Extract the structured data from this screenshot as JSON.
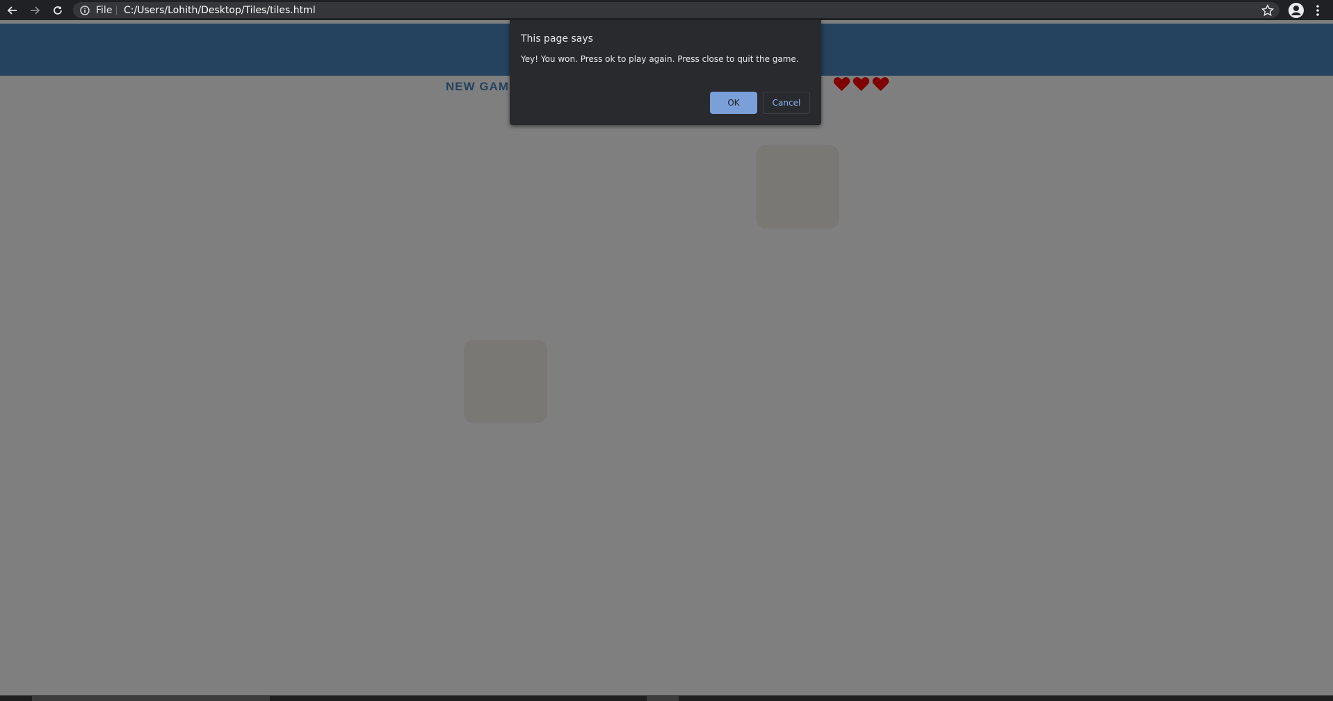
{
  "browser": {
    "scheme_label": "File",
    "url": "C:/Users/Lohith/Desktop/Tiles/tiles.html",
    "icons": {
      "back": "arrow-left-icon",
      "forward": "arrow-right-icon",
      "reload": "reload-icon",
      "info": "info-icon",
      "bookmark": "star-icon",
      "account": "account-icon",
      "menu": "kebab-menu-icon"
    }
  },
  "game": {
    "new_game_label": "NEW GAME",
    "lives": 3,
    "colors": {
      "header": "#4a86bd",
      "heart": "#ff0000",
      "tile": "#f4f0ea"
    }
  },
  "dialog": {
    "title": "This page says",
    "message": "Yey! You won. Press ok to play again. Press close to quit the game.",
    "ok_label": "OK",
    "cancel_label": "Cancel"
  }
}
